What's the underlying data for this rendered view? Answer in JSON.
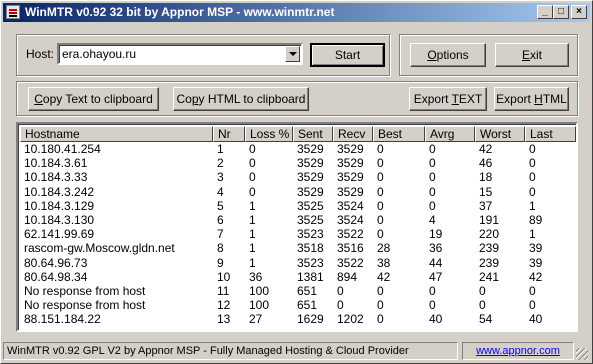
{
  "window": {
    "title": "WinMTR v0.92 32 bit by Appnor MSP - www.winmtr.net",
    "minimize": "_",
    "maximize": "□",
    "close": "×"
  },
  "host": {
    "label": "Host:",
    "value": "era.ohayou.ru"
  },
  "buttons": {
    "start": "Start",
    "options": "Options",
    "options_u": "O",
    "options_rest": "ptions",
    "exit_u": "E",
    "exit_rest": "xit",
    "copy_text_u": "C",
    "copy_text_rest": "opy Text to clipboard",
    "copy_html_pre": "Co",
    "copy_html_u": "p",
    "copy_html_rest": "y HTML to clipboard",
    "export_text_pre": "Export ",
    "export_text_u": "T",
    "export_text_rest": "EXT",
    "export_html_pre": "Export ",
    "export_html_u": "H",
    "export_html_rest": "TML"
  },
  "table": {
    "columns": [
      "Hostname",
      "Nr",
      "Loss %",
      "Sent",
      "Recv",
      "Best",
      "Avrg",
      "Worst",
      "Last"
    ],
    "rows": [
      [
        "10.180.41.254",
        "1",
        "0",
        "3529",
        "3529",
        "0",
        "0",
        "42",
        "0"
      ],
      [
        "10.184.3.61",
        "2",
        "0",
        "3529",
        "3529",
        "0",
        "0",
        "46",
        "0"
      ],
      [
        "10.184.3.33",
        "3",
        "0",
        "3529",
        "3529",
        "0",
        "0",
        "18",
        "0"
      ],
      [
        "10.184.3.242",
        "4",
        "0",
        "3529",
        "3529",
        "0",
        "0",
        "15",
        "0"
      ],
      [
        "10.184.3.129",
        "5",
        "1",
        "3525",
        "3524",
        "0",
        "0",
        "37",
        "1"
      ],
      [
        "10.184.3.130",
        "6",
        "1",
        "3525",
        "3524",
        "0",
        "4",
        "191",
        "89"
      ],
      [
        "62.141.99.69",
        "7",
        "1",
        "3523",
        "3522",
        "0",
        "19",
        "220",
        "1"
      ],
      [
        "rascom-gw.Moscow.gldn.net",
        "8",
        "1",
        "3518",
        "3516",
        "28",
        "36",
        "239",
        "39"
      ],
      [
        "80.64.96.73",
        "9",
        "1",
        "3523",
        "3522",
        "38",
        "44",
        "239",
        "39"
      ],
      [
        "80.64.98.34",
        "10",
        "36",
        "1381",
        "894",
        "42",
        "47",
        "241",
        "42"
      ],
      [
        "No response from host",
        "11",
        "100",
        "651",
        "0",
        "0",
        "0",
        "0",
        "0"
      ],
      [
        "No response from host",
        "12",
        "100",
        "651",
        "0",
        "0",
        "0",
        "0",
        "0"
      ],
      [
        "88.151.184.22",
        "13",
        "27",
        "1629",
        "1202",
        "0",
        "40",
        "54",
        "40"
      ]
    ]
  },
  "status": {
    "text": "WinMTR v0.92 GPL V2 by Appnor MSP - Fully Managed Hosting & Cloud Provider",
    "link": "www.appnor.com"
  }
}
